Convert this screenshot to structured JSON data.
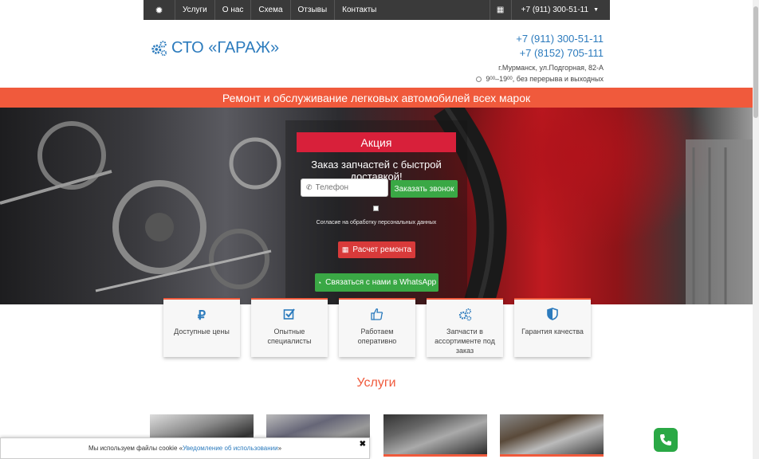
{
  "nav": {
    "items": [
      "Услуги",
      "О нас",
      "Схема",
      "Отзывы",
      "Контакты"
    ],
    "phone": "+7 (911) 300-51-11"
  },
  "header": {
    "logo_text": "СТО «ГАРАЖ»",
    "phone1": "+7 (911) 300-51-11",
    "phone2": "+7 (8152) 705-111",
    "address": "г.Мурманск, ул.Подгорная, 82-А",
    "hours_from": "9",
    "hours_from_sup": "00",
    "hours_to": "19",
    "hours_to_sup": "00",
    "hours_note": ", без перерыва и выходных"
  },
  "band": {
    "text": "Ремонт и обслуживание легковых автомобилей всех марок"
  },
  "promo": {
    "badge": "Акция",
    "subtitle": "Заказ запчастей с быстрой доставкой!",
    "phone_placeholder": "Телефон",
    "callback_label": "Заказать звонок",
    "consent": "Согласие на обработку персональных данных",
    "repair_label": "Расчет ремонта",
    "whatsapp_label": "Связаться с нами в WhatsApp"
  },
  "features": [
    {
      "icon": "ruble-icon",
      "label": "Доступные цены"
    },
    {
      "icon": "check-square-icon",
      "label": "Опытные специалисты"
    },
    {
      "icon": "thumbs-up-icon",
      "label": "Работаем оперативно"
    },
    {
      "icon": "cogs-icon",
      "label": "Запчасти в ассортименте под заказ"
    },
    {
      "icon": "shield-icon",
      "label": "Гарантия качества"
    }
  ],
  "services": {
    "title": "Услуги"
  },
  "cookie": {
    "text": "Мы используем файлы cookie «",
    "link": "Уведомление об использовании",
    "suffix": "»",
    "close": "✖"
  },
  "colors": {
    "accent": "#f05a3c",
    "brand_blue": "#2c7bbd",
    "green": "#3aa845",
    "red_badge": "#d8203a"
  }
}
